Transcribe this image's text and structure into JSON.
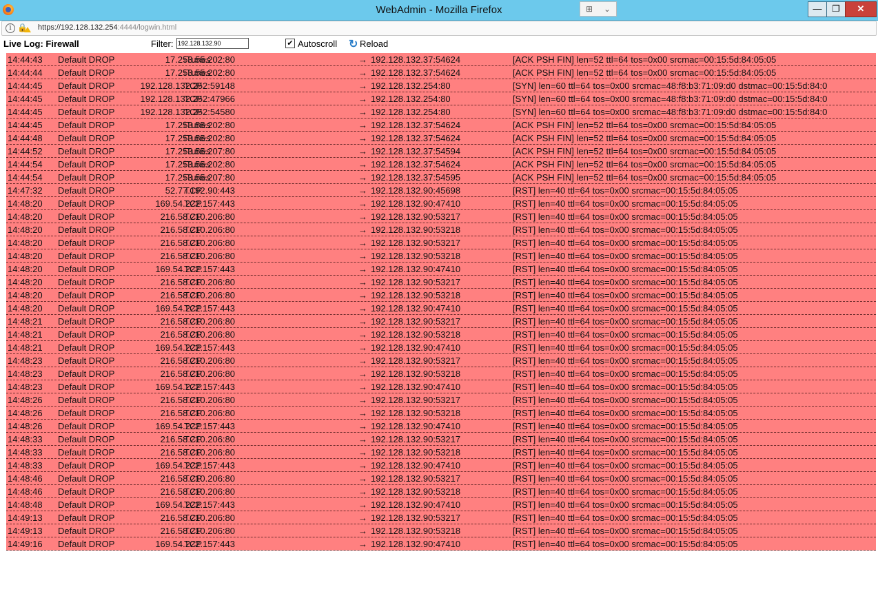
{
  "window": {
    "title": "WebAdmin - Mozilla Firefox",
    "btn_min": "—",
    "btn_max": "❐",
    "btn_close": "✕"
  },
  "urlbar": {
    "host": "https://192.128.132.254",
    "rest": ":4444/logwin.html"
  },
  "toolbar": {
    "title": "Live Log: Firewall",
    "filter_label": "Filter:",
    "filter_value": "192.128.132.90",
    "autoscroll_label": "Autoscroll",
    "autoscroll_checked": true,
    "reload_label": "Reload"
  },
  "colors": {
    "row_bg": "#ff8080",
    "titlebar": "#6cc9ec"
  },
  "log": [
    {
      "time": "14:44:43",
      "action": "Default DROP",
      "proto": "iTunes",
      "src": "17.253.55.202:80",
      "dst": "192.128.132.37:54624",
      "info": "[ACK PSH FIN]  len=52  ttl=64  tos=0x00  srcmac=00:15:5d:84:05:05"
    },
    {
      "time": "14:44:44",
      "action": "Default DROP",
      "proto": "iTunes",
      "src": "17.253.55.202:80",
      "dst": "192.128.132.37:54624",
      "info": "[ACK PSH FIN]  len=52  ttl=64  tos=0x00  srcmac=00:15:5d:84:05:05"
    },
    {
      "time": "14:44:45",
      "action": "Default DROP",
      "proto": "TCP",
      "src": "192.128.132.252:59148",
      "dst": "192.128.132.254:80",
      "info": "[SYN]  len=60  ttl=64  tos=0x00  srcmac=48:f8:b3:71:09:d0  dstmac=00:15:5d:84:0"
    },
    {
      "time": "14:44:45",
      "action": "Default DROP",
      "proto": "TCP",
      "src": "192.128.132.252:47966",
      "dst": "192.128.132.254:80",
      "info": "[SYN]  len=60  ttl=64  tos=0x00  srcmac=48:f8:b3:71:09:d0  dstmac=00:15:5d:84:0"
    },
    {
      "time": "14:44:45",
      "action": "Default DROP",
      "proto": "TCP",
      "src": "192.128.132.252:54580",
      "dst": "192.128.132.254:80",
      "info": "[SYN]  len=60  ttl=64  tos=0x00  srcmac=48:f8:b3:71:09:d0  dstmac=00:15:5d:84:0"
    },
    {
      "time": "14:44:45",
      "action": "Default DROP",
      "proto": "iTunes",
      "src": "17.253.55.202:80",
      "dst": "192.128.132.37:54624",
      "info": "[ACK PSH FIN]  len=52  ttl=64  tos=0x00  srcmac=00:15:5d:84:05:05"
    },
    {
      "time": "14:44:48",
      "action": "Default DROP",
      "proto": "iTunes",
      "src": "17.253.55.202:80",
      "dst": "192.128.132.37:54624",
      "info": "[ACK PSH FIN]  len=52  ttl=64  tos=0x00  srcmac=00:15:5d:84:05:05"
    },
    {
      "time": "14:44:52",
      "action": "Default DROP",
      "proto": "iTunes",
      "src": "17.253.55.207:80",
      "dst": "192.128.132.37:54594",
      "info": "[ACK PSH FIN]  len=52  ttl=64  tos=0x00  srcmac=00:15:5d:84:05:05"
    },
    {
      "time": "14:44:54",
      "action": "Default DROP",
      "proto": "iTunes",
      "src": "17.253.55.202:80",
      "dst": "192.128.132.37:54624",
      "info": "[ACK PSH FIN]  len=52  ttl=64  tos=0x00  srcmac=00:15:5d:84:05:05"
    },
    {
      "time": "14:44:54",
      "action": "Default DROP",
      "proto": "iTunes",
      "src": "17.253.55.207:80",
      "dst": "192.128.132.37:54595",
      "info": "[ACK PSH FIN]  len=52  ttl=64  tos=0x00  srcmac=00:15:5d:84:05:05"
    },
    {
      "time": "14:47:32",
      "action": "Default DROP",
      "proto": "TCP",
      "src": "52.77.192.90:443",
      "dst": "192.128.132.90:45698",
      "info": "[RST]  len=40  ttl=64  tos=0x00  srcmac=00:15:5d:84:05:05"
    },
    {
      "time": "14:48:20",
      "action": "Default DROP",
      "proto": "TCP",
      "src": "169.54.222.157:443",
      "dst": "192.128.132.90:47410",
      "info": "[RST]  len=40  ttl=64  tos=0x00  srcmac=00:15:5d:84:05:05"
    },
    {
      "time": "14:48:20",
      "action": "Default DROP",
      "proto": "TCP",
      "src": "216.58.210.206:80",
      "dst": "192.128.132.90:53217",
      "info": "[RST]  len=40  ttl=64  tos=0x00  srcmac=00:15:5d:84:05:05"
    },
    {
      "time": "14:48:20",
      "action": "Default DROP",
      "proto": "TCP",
      "src": "216.58.210.206:80",
      "dst": "192.128.132.90:53218",
      "info": "[RST]  len=40  ttl=64  tos=0x00  srcmac=00:15:5d:84:05:05"
    },
    {
      "time": "14:48:20",
      "action": "Default DROP",
      "proto": "TCP",
      "src": "216.58.210.206:80",
      "dst": "192.128.132.90:53217",
      "info": "[RST]  len=40  ttl=64  tos=0x00  srcmac=00:15:5d:84:05:05"
    },
    {
      "time": "14:48:20",
      "action": "Default DROP",
      "proto": "TCP",
      "src": "216.58.210.206:80",
      "dst": "192.128.132.90:53218",
      "info": "[RST]  len=40  ttl=64  tos=0x00  srcmac=00:15:5d:84:05:05"
    },
    {
      "time": "14:48:20",
      "action": "Default DROP",
      "proto": "TCP",
      "src": "169.54.222.157:443",
      "dst": "192.128.132.90:47410",
      "info": "[RST]  len=40  ttl=64  tos=0x00  srcmac=00:15:5d:84:05:05"
    },
    {
      "time": "14:48:20",
      "action": "Default DROP",
      "proto": "TCP",
      "src": "216.58.210.206:80",
      "dst": "192.128.132.90:53217",
      "info": "[RST]  len=40  ttl=64  tos=0x00  srcmac=00:15:5d:84:05:05"
    },
    {
      "time": "14:48:20",
      "action": "Default DROP",
      "proto": "TCP",
      "src": "216.58.210.206:80",
      "dst": "192.128.132.90:53218",
      "info": "[RST]  len=40  ttl=64  tos=0x00  srcmac=00:15:5d:84:05:05"
    },
    {
      "time": "14:48:20",
      "action": "Default DROP",
      "proto": "TCP",
      "src": "169.54.222.157:443",
      "dst": "192.128.132.90:47410",
      "info": "[RST]  len=40  ttl=64  tos=0x00  srcmac=00:15:5d:84:05:05"
    },
    {
      "time": "14:48:21",
      "action": "Default DROP",
      "proto": "TCP",
      "src": "216.58.210.206:80",
      "dst": "192.128.132.90:53217",
      "info": "[RST]  len=40  ttl=64  tos=0x00  srcmac=00:15:5d:84:05:05"
    },
    {
      "time": "14:48:21",
      "action": "Default DROP",
      "proto": "TCP",
      "src": "216.58.210.206:80",
      "dst": "192.128.132.90:53218",
      "info": "[RST]  len=40  ttl=64  tos=0x00  srcmac=00:15:5d:84:05:05"
    },
    {
      "time": "14:48:21",
      "action": "Default DROP",
      "proto": "TCP",
      "src": "169.54.222.157:443",
      "dst": "192.128.132.90:47410",
      "info": "[RST]  len=40  ttl=64  tos=0x00  srcmac=00:15:5d:84:05:05"
    },
    {
      "time": "14:48:23",
      "action": "Default DROP",
      "proto": "TCP",
      "src": "216.58.210.206:80",
      "dst": "192.128.132.90:53217",
      "info": "[RST]  len=40  ttl=64  tos=0x00  srcmac=00:15:5d:84:05:05"
    },
    {
      "time": "14:48:23",
      "action": "Default DROP",
      "proto": "TCP",
      "src": "216.58.210.206:80",
      "dst": "192.128.132.90:53218",
      "info": "[RST]  len=40  ttl=64  tos=0x00  srcmac=00:15:5d:84:05:05"
    },
    {
      "time": "14:48:23",
      "action": "Default DROP",
      "proto": "TCP",
      "src": "169.54.222.157:443",
      "dst": "192.128.132.90:47410",
      "info": "[RST]  len=40  ttl=64  tos=0x00  srcmac=00:15:5d:84:05:05"
    },
    {
      "time": "14:48:26",
      "action": "Default DROP",
      "proto": "TCP",
      "src": "216.58.210.206:80",
      "dst": "192.128.132.90:53217",
      "info": "[RST]  len=40  ttl=64  tos=0x00  srcmac=00:15:5d:84:05:05"
    },
    {
      "time": "14:48:26",
      "action": "Default DROP",
      "proto": "TCP",
      "src": "216.58.210.206:80",
      "dst": "192.128.132.90:53218",
      "info": "[RST]  len=40  ttl=64  tos=0x00  srcmac=00:15:5d:84:05:05"
    },
    {
      "time": "14:48:26",
      "action": "Default DROP",
      "proto": "TCP",
      "src": "169.54.222.157:443",
      "dst": "192.128.132.90:47410",
      "info": "[RST]  len=40  ttl=64  tos=0x00  srcmac=00:15:5d:84:05:05"
    },
    {
      "time": "14:48:33",
      "action": "Default DROP",
      "proto": "TCP",
      "src": "216.58.210.206:80",
      "dst": "192.128.132.90:53217",
      "info": "[RST]  len=40  ttl=64  tos=0x00  srcmac=00:15:5d:84:05:05"
    },
    {
      "time": "14:48:33",
      "action": "Default DROP",
      "proto": "TCP",
      "src": "216.58.210.206:80",
      "dst": "192.128.132.90:53218",
      "info": "[RST]  len=40  ttl=64  tos=0x00  srcmac=00:15:5d:84:05:05"
    },
    {
      "time": "14:48:33",
      "action": "Default DROP",
      "proto": "TCP",
      "src": "169.54.222.157:443",
      "dst": "192.128.132.90:47410",
      "info": "[RST]  len=40  ttl=64  tos=0x00  srcmac=00:15:5d:84:05:05"
    },
    {
      "time": "14:48:46",
      "action": "Default DROP",
      "proto": "TCP",
      "src": "216.58.210.206:80",
      "dst": "192.128.132.90:53217",
      "info": "[RST]  len=40  ttl=64  tos=0x00  srcmac=00:15:5d:84:05:05"
    },
    {
      "time": "14:48:46",
      "action": "Default DROP",
      "proto": "TCP",
      "src": "216.58.210.206:80",
      "dst": "192.128.132.90:53218",
      "info": "[RST]  len=40  ttl=64  tos=0x00  srcmac=00:15:5d:84:05:05"
    },
    {
      "time": "14:48:48",
      "action": "Default DROP",
      "proto": "TCP",
      "src": "169.54.222.157:443",
      "dst": "192.128.132.90:47410",
      "info": "[RST]  len=40  ttl=64  tos=0x00  srcmac=00:15:5d:84:05:05"
    },
    {
      "time": "14:49:13",
      "action": "Default DROP",
      "proto": "TCP",
      "src": "216.58.210.206:80",
      "dst": "192.128.132.90:53217",
      "info": "[RST]  len=40  ttl=64  tos=0x00  srcmac=00:15:5d:84:05:05"
    },
    {
      "time": "14:49:13",
      "action": "Default DROP",
      "proto": "TCP",
      "src": "216.58.210.206:80",
      "dst": "192.128.132.90:53218",
      "info": "[RST]  len=40  ttl=64  tos=0x00  srcmac=00:15:5d:84:05:05"
    },
    {
      "time": "14:49:16",
      "action": "Default DROP",
      "proto": "TCP",
      "src": "169.54.222.157:443",
      "dst": "192.128.132.90:47410",
      "info": "[RST]  len=40  ttl=64  tos=0x00  srcmac=00:15:5d:84:05:05"
    }
  ]
}
